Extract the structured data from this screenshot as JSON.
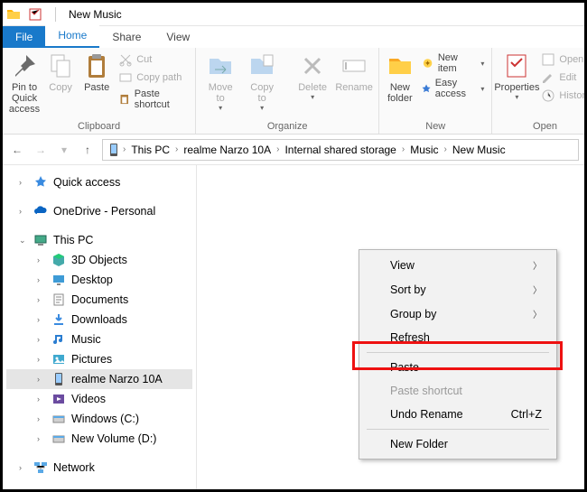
{
  "titlebar": {
    "title": "New Music"
  },
  "tabs": {
    "file": "File",
    "home": "Home",
    "share": "Share",
    "view": "View"
  },
  "ribbon": {
    "clipboard": {
      "label": "Clipboard",
      "pin": "Pin to Quick\naccess",
      "copy": "Copy",
      "paste": "Paste",
      "cut": "Cut",
      "copy_path": "Copy path",
      "paste_shortcut": "Paste shortcut"
    },
    "organize": {
      "label": "Organize",
      "move_to": "Move\nto",
      "copy_to": "Copy\nto",
      "delete": "Delete",
      "rename": "Rename"
    },
    "new": {
      "label": "New",
      "new_folder": "New\nfolder",
      "new_item": "New item",
      "easy_access": "Easy access"
    },
    "open": {
      "label": "Open",
      "properties": "Properties",
      "open": "Open",
      "edit": "Edit",
      "history": "History"
    }
  },
  "nav": {
    "crumbs": [
      "This PC",
      "realme Narzo 10A",
      "Internal shared storage",
      "Music",
      "New Music"
    ]
  },
  "sidebar": {
    "quick_access": "Quick access",
    "onedrive": "OneDrive - Personal",
    "this_pc": "This PC",
    "children": [
      {
        "label": "3D Objects"
      },
      {
        "label": "Desktop"
      },
      {
        "label": "Documents"
      },
      {
        "label": "Downloads"
      },
      {
        "label": "Music"
      },
      {
        "label": "Pictures"
      },
      {
        "label": "realme Narzo 10A",
        "selected": true
      },
      {
        "label": "Videos"
      },
      {
        "label": "Windows (C:)"
      },
      {
        "label": "New Volume (D:)"
      }
    ],
    "network": "Network"
  },
  "context_menu": {
    "view": "View",
    "sort_by": "Sort by",
    "group_by": "Group by",
    "refresh": "Refresh",
    "paste": "Paste",
    "paste_shortcut": "Paste shortcut",
    "undo": "Undo Rename",
    "undo_accel": "Ctrl+Z",
    "new_folder": "New Folder"
  }
}
